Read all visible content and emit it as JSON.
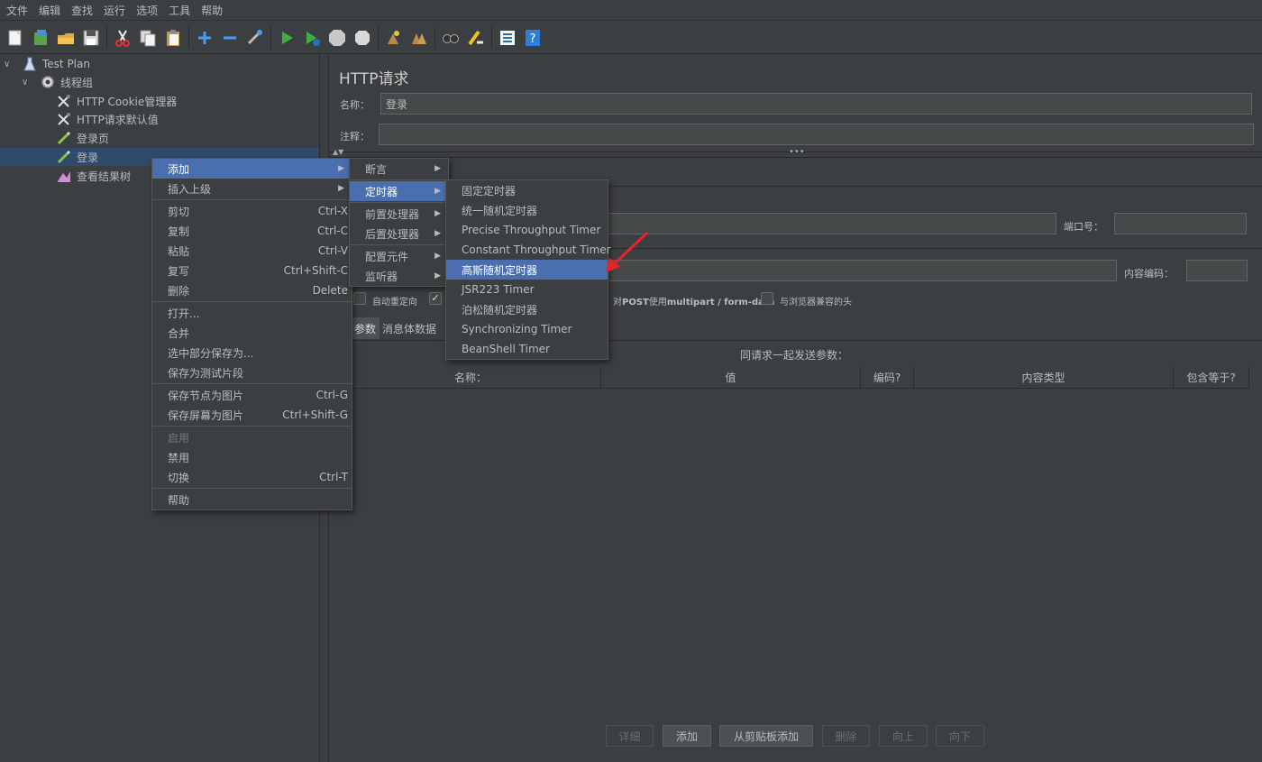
{
  "menubar": [
    "文件",
    "编辑",
    "查找",
    "运行",
    "选项",
    "工具",
    "帮助"
  ],
  "toolbar_icons": [
    "new-icon",
    "templates-icon",
    "open-icon",
    "save-icon",
    "cut-icon",
    "copy-icon",
    "paste-icon",
    "expand-icon",
    "collapse-icon",
    "toggle-icon",
    "start-icon",
    "start-no-pause-icon",
    "stop-icon",
    "shutdown-icon",
    "clear-icon",
    "clear-all-icon",
    "search-icon",
    "reset-search-icon",
    "function-helper-icon",
    "help-icon"
  ],
  "tree": {
    "nodes": [
      {
        "label": "Test Plan",
        "icon": "test-plan-icon"
      },
      {
        "label": "线程组",
        "icon": "gear-icon"
      },
      {
        "label": "HTTP Cookie管理器",
        "icon": "wrench-icon"
      },
      {
        "label": "HTTP请求默认值",
        "icon": "wrench-icon"
      },
      {
        "label": "登录页",
        "icon": "pencil-icon"
      },
      {
        "label": "登录",
        "icon": "pencil-icon"
      },
      {
        "label": "查看结果树",
        "icon": "listener-icon"
      }
    ]
  },
  "editor": {
    "title": "HTTP请求",
    "name_label": "名称：",
    "name_value": "登录",
    "comment_label": "注释：",
    "port_label": "端口号：",
    "encoding_label": "内容编码：",
    "follow_redirect_label": "自动重定向",
    "multipart_label_prefix": "对",
    "multipart_label_bold": "POST",
    "multipart_label_mid": "使用",
    "multipart_label_bold2": "multipart / form-data",
    "browser_headers_label": "与浏览器兼容的头",
    "tab_params": "参数",
    "tab_body": "消息体数据",
    "params_caption": "同请求一起发送参数：",
    "table_headers": [
      "名称：",
      "值",
      "编码?",
      "内容类型",
      "包含等于?"
    ],
    "buttons": {
      "detail": "详细",
      "add": "添加",
      "add_clipboard": "从剪贴板添加",
      "delete": "删除",
      "up": "向上",
      "down": "向下"
    }
  },
  "context_menu": {
    "items": [
      {
        "label": "添加",
        "submenu": true,
        "highlight": true
      },
      {
        "label": "插入上级",
        "submenu": true
      },
      {
        "sep": true
      },
      {
        "label": "剪切",
        "key": "Ctrl-X"
      },
      {
        "label": "复制",
        "key": "Ctrl-C"
      },
      {
        "label": "粘贴",
        "key": "Ctrl-V"
      },
      {
        "label": "复写",
        "key": "Ctrl+Shift-C"
      },
      {
        "label": "删除",
        "key": "Delete"
      },
      {
        "sep": true
      },
      {
        "label": "打开..."
      },
      {
        "label": "合并"
      },
      {
        "label": "选中部分保存为..."
      },
      {
        "label": "保存为测试片段"
      },
      {
        "sep": true
      },
      {
        "label": "保存节点为图片",
        "key": "Ctrl-G"
      },
      {
        "label": "保存屏幕为图片",
        "key": "Ctrl+Shift-G"
      },
      {
        "sep": true
      },
      {
        "label": "启用",
        "disabled": true
      },
      {
        "label": "禁用"
      },
      {
        "label": "切换",
        "key": "Ctrl-T"
      },
      {
        "sep": true
      },
      {
        "label": "帮助"
      }
    ]
  },
  "add_submenu": {
    "items": [
      {
        "label": "断言",
        "submenu": true
      },
      {
        "sep": true
      },
      {
        "label": "定时器",
        "submenu": true,
        "highlight": true
      },
      {
        "sep": true
      },
      {
        "label": "前置处理器",
        "submenu": true
      },
      {
        "label": "后置处理器",
        "submenu": true
      },
      {
        "sep": true
      },
      {
        "label": "配置元件",
        "submenu": true
      },
      {
        "label": "监听器",
        "submenu": true
      }
    ]
  },
  "timer_submenu": {
    "items": [
      {
        "label": "固定定时器"
      },
      {
        "label": "统一随机定时器"
      },
      {
        "label": "Precise Throughput Timer"
      },
      {
        "label": "Constant Throughput Timer"
      },
      {
        "label": "高斯随机定时器",
        "highlight": true
      },
      {
        "label": "JSR223 Timer"
      },
      {
        "label": "泊松随机定时器"
      },
      {
        "label": "Synchronizing Timer"
      },
      {
        "label": "BeanShell Timer"
      }
    ]
  },
  "colors": {
    "accent": "#4b6eaf",
    "background": "#3c3f41",
    "arrow": "#e8242a"
  }
}
